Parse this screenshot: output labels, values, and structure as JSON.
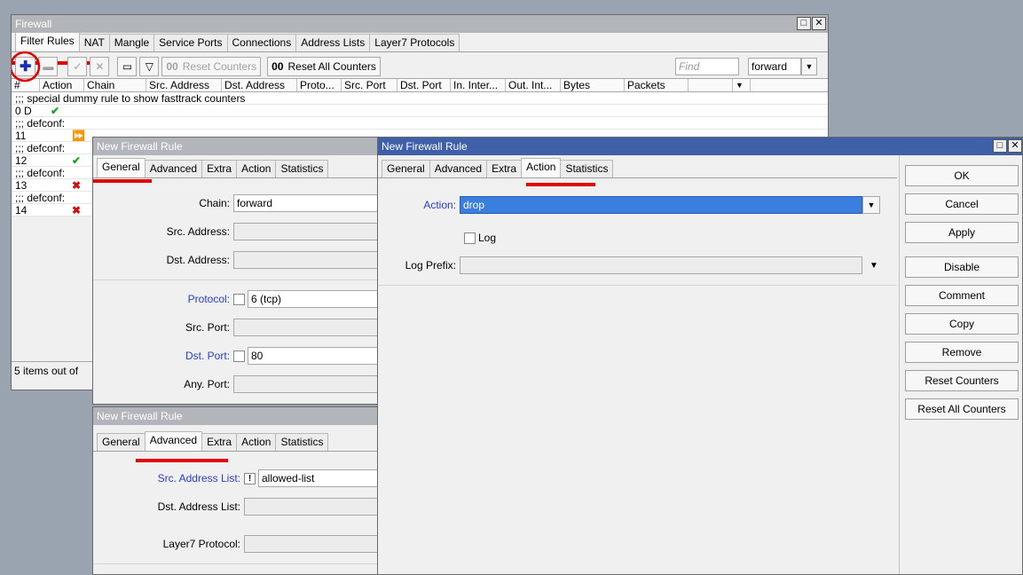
{
  "firewall": {
    "title": "Firewall",
    "tabs": [
      "Filter Rules",
      "NAT",
      "Mangle",
      "Service Ports",
      "Connections",
      "Address Lists",
      "Layer7 Protocols"
    ],
    "toolbar": {
      "reset_counters": "Reset Counters",
      "reset_all_counters": "Reset All Counters",
      "oo": "00",
      "find_placeholder": "Find",
      "chain_filter": "forward"
    },
    "columns": [
      "#",
      "Action",
      "Chain",
      "Src. Address",
      "Dst. Address",
      "Proto...",
      "Src. Port",
      "Dst. Port",
      "In. Inter...",
      "Out. Int...",
      "Bytes",
      "Packets"
    ],
    "rows": [
      ";;; special dummy rule to show fasttrack counters",
      "0  D",
      ";;; defconf:",
      "11",
      ";;; defconf:",
      "12",
      ";;; defconf:",
      "13",
      ";;; defconf:",
      "14"
    ],
    "status": "5 items out of"
  },
  "rule_general": {
    "title": "New Firewall Rule",
    "tabs": [
      "General",
      "Advanced",
      "Extra",
      "Action",
      "Statistics"
    ],
    "chain_label": "Chain:",
    "chain_value": "forward",
    "src_address_label": "Src. Address:",
    "dst_address_label": "Dst. Address:",
    "protocol_label": "Protocol:",
    "protocol_value": "6 (tcp)",
    "src_port_label": "Src. Port:",
    "dst_port_label": "Dst. Port:",
    "dst_port_value": "80",
    "any_port_label": "Any. Port:"
  },
  "rule_advanced": {
    "title": "New Firewall Rule",
    "tabs": [
      "General",
      "Advanced",
      "Extra",
      "Action",
      "Statistics"
    ],
    "src_list_label": "Src. Address List:",
    "src_list_value": "allowed-list",
    "dst_list_label": "Dst. Address List:",
    "layer7_label": "Layer7 Protocol:"
  },
  "rule_action": {
    "title": "New Firewall Rule",
    "tabs": [
      "General",
      "Advanced",
      "Extra",
      "Action",
      "Statistics"
    ],
    "action_label": "Action:",
    "action_value": "drop",
    "log_label": "Log",
    "log_prefix_label": "Log Prefix:",
    "buttons": [
      "OK",
      "Cancel",
      "Apply",
      "Disable",
      "Comment",
      "Copy",
      "Remove",
      "Reset Counters",
      "Reset All Counters"
    ]
  }
}
